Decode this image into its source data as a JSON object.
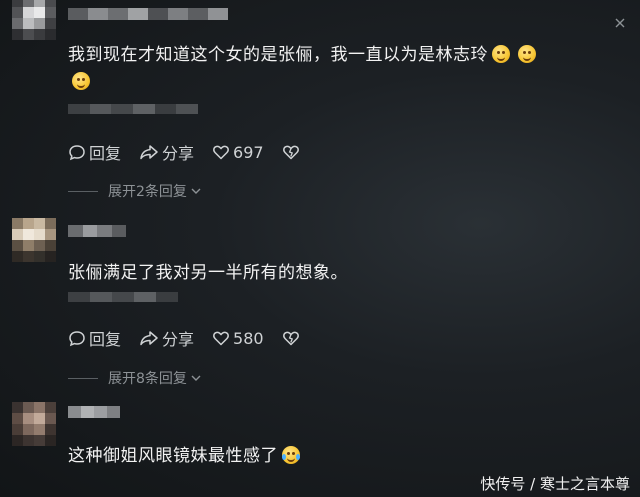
{
  "comments": [
    {
      "text": "我到现在才知道这个女的是张俪，我一直以为是林志玲",
      "reply_label": "回复",
      "share_label": "分享",
      "like_count": "697",
      "expand_label": "展开2条回复"
    },
    {
      "text": "张俪满足了我对另一半所有的想象。",
      "reply_label": "回复",
      "share_label": "分享",
      "like_count": "580",
      "expand_label": "展开8条回复"
    },
    {
      "text": "这种御姐风眼镜妹最性感了"
    }
  ],
  "icons": [
    "reply-icon",
    "share-icon",
    "heart-icon",
    "dislike-heart-icon",
    "chevron-down-icon",
    "close-icon",
    "emoji-smile-icon",
    "emoji-laugh-tears-icon"
  ],
  "watermark": "快传号 / 寒士之言本尊",
  "colors": {
    "background": "#1c2024",
    "text": "#f2f2f2",
    "muted": "#8d9296"
  }
}
